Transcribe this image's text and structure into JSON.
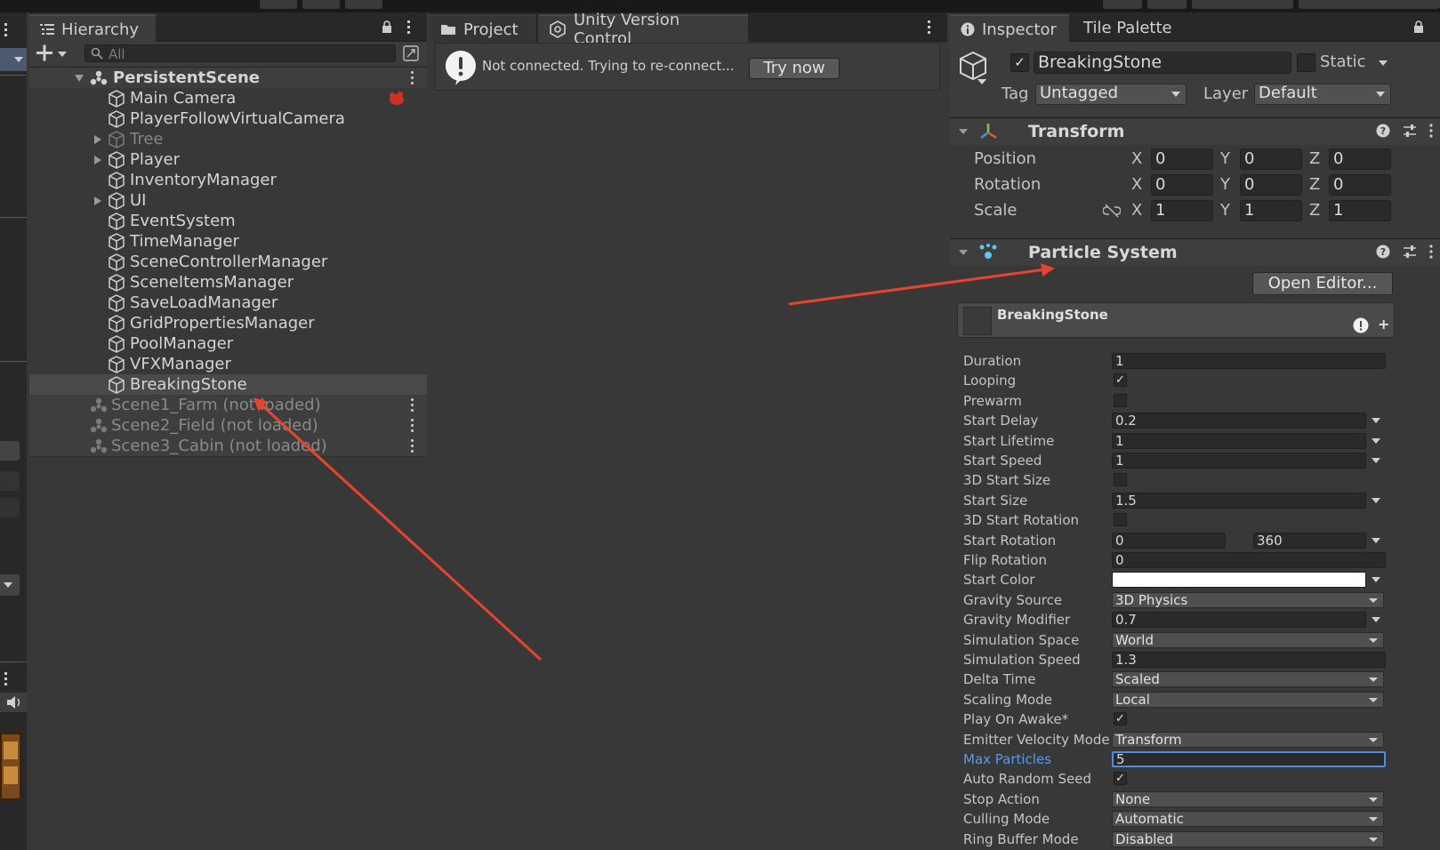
{
  "hierarchy": {
    "tab_label": "Hierarchy",
    "search_placeholder": "All",
    "scene": "PersistentScene",
    "items": [
      "Main Camera",
      "PlayerFollowVirtualCamera",
      "Tree",
      "Player",
      "InventoryManager",
      "UI",
      "EventSystem",
      "TimeManager",
      "SceneControllerManager",
      "SceneItemsManager",
      "SaveLoadManager",
      "GridPropertiesManager",
      "PoolManager",
      "VFXManager",
      "BreakingStone"
    ],
    "unloaded_scenes": [
      "Scene1_Farm (not loaded)",
      "Scene2_Field (not loaded)",
      "Scene3_Cabin (not loaded)"
    ]
  },
  "project": {
    "tabs": [
      "Project",
      "Unity Version Control"
    ],
    "notice": "Not connected. Trying to re-connect...",
    "try_button": "Try now"
  },
  "inspector": {
    "tabs": [
      "Inspector",
      "Tile Palette"
    ],
    "object_name": "BreakingStone",
    "static_label": "Static",
    "tag_label": "Tag",
    "tag_value": "Untagged",
    "layer_label": "Layer",
    "layer_value": "Default",
    "transform": {
      "title": "Transform",
      "rows": [
        {
          "label": "Position",
          "x": "0",
          "y": "0",
          "z": "0"
        },
        {
          "label": "Rotation",
          "x": "0",
          "y": "0",
          "z": "0"
        },
        {
          "label": "Scale",
          "x": "1",
          "y": "1",
          "z": "1"
        }
      ],
      "axis_x": "X",
      "axis_y": "Y",
      "axis_z": "Z"
    },
    "particle_system": {
      "title": "Particle System",
      "open_editor": "Open Editor...",
      "module_name": "BreakingStone",
      "props": {
        "duration": {
          "label": "Duration",
          "value": "1"
        },
        "looping": {
          "label": "Looping",
          "checked": true
        },
        "prewarm": {
          "label": "Prewarm",
          "checked": false
        },
        "start_delay": {
          "label": "Start Delay",
          "value": "0.2"
        },
        "start_lifetime": {
          "label": "Start Lifetime",
          "value": "1"
        },
        "start_speed": {
          "label": "Start Speed",
          "value": "1"
        },
        "start_size_3d": {
          "label": "3D Start Size",
          "checked": false
        },
        "start_size": {
          "label": "Start Size",
          "value": "1.5"
        },
        "start_rotation_3d": {
          "label": "3D Start Rotation",
          "checked": false
        },
        "start_rotation": {
          "label": "Start Rotation",
          "min": "0",
          "max": "360"
        },
        "flip_rotation": {
          "label": "Flip Rotation",
          "value": "0"
        },
        "start_color": {
          "label": "Start Color",
          "color": "#ffffff"
        },
        "gravity_source": {
          "label": "Gravity Source",
          "value": "3D Physics"
        },
        "gravity_modifier": {
          "label": "Gravity Modifier",
          "value": "0.7"
        },
        "simulation_space": {
          "label": "Simulation Space",
          "value": "World"
        },
        "simulation_speed": {
          "label": "Simulation Speed",
          "value": "1.3"
        },
        "delta_time": {
          "label": "Delta Time",
          "value": "Scaled"
        },
        "scaling_mode": {
          "label": "Scaling Mode",
          "value": "Local"
        },
        "play_on_awake": {
          "label": "Play On Awake*",
          "checked": true
        },
        "emitter_velocity_mode": {
          "label": "Emitter Velocity Mode",
          "value": "Transform"
        },
        "max_particles": {
          "label": "Max Particles",
          "value": "5"
        },
        "auto_random_seed": {
          "label": "Auto Random Seed",
          "checked": true
        },
        "stop_action": {
          "label": "Stop Action",
          "value": "None"
        },
        "culling_mode": {
          "label": "Culling Mode",
          "value": "Automatic"
        },
        "ring_buffer_mode": {
          "label": "Ring Buffer Mode",
          "value": "Disabled"
        }
      }
    }
  },
  "colors": {
    "annotation_arrow": "#e8432e",
    "focus_blue": "#4c8ee6",
    "selected_row": "#4a4a4a"
  }
}
